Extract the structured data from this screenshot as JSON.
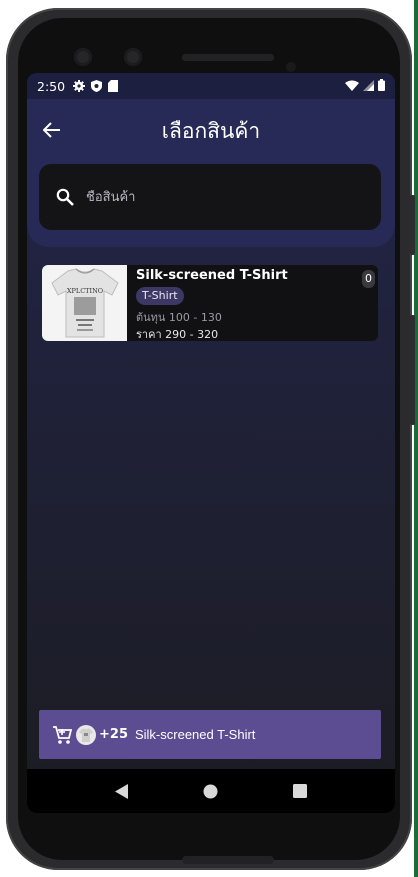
{
  "status": {
    "time": "2:50",
    "icons": [
      "gear-icon",
      "shield-icon",
      "sd-card-icon",
      "wifi-icon",
      "signal-icon",
      "battery-icon"
    ]
  },
  "header": {
    "title": "เลือกสินค้า",
    "back_icon": "arrow-left-icon"
  },
  "search": {
    "placeholder": "ชื่อสินค้า",
    "value": "",
    "icon": "search-icon"
  },
  "products": [
    {
      "name": "Silk-screened T-Shirt",
      "category": "T-Shirt",
      "cost": "ต้นทุน 100 - 130",
      "price": "ราคา 290 - 320",
      "count": "0",
      "thumb_text": "XPLCTINO"
    }
  ],
  "cart": {
    "icon": "cart-icon",
    "plus": "+25",
    "product": "Silk-screened T-Shirt"
  },
  "nav": {
    "back": "nav-back-icon",
    "home": "nav-home-icon",
    "recents": "nav-recents-icon"
  },
  "colors": {
    "appbar": "#272a56",
    "accent": "#5c4d92",
    "chip": "#3d3764"
  }
}
